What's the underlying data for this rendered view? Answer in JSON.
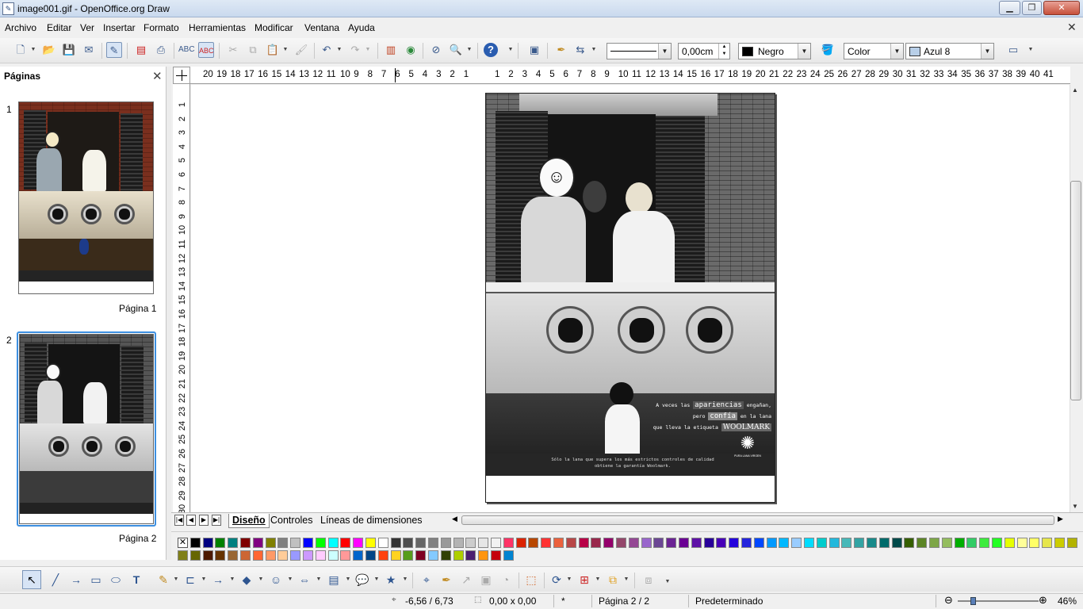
{
  "window": {
    "title": "image001.gif - OpenOffice.org Draw",
    "min_label": "▁",
    "max_label": "❐",
    "close_label": "✕"
  },
  "menu": {
    "items": [
      "Archivo",
      "Editar",
      "Ver",
      "Insertar",
      "Formato",
      "Herramientas",
      "Modificar",
      "Ventana",
      "Ayuda"
    ],
    "close_label": "✕"
  },
  "toolbar": {
    "line_width": "0,00cm",
    "line_color": "Negro",
    "line_color_hex": "#000000",
    "area_style": "Color",
    "area_color": "Azul 8",
    "area_color_hex": "#b8cfe8"
  },
  "pages_panel": {
    "title": "Páginas",
    "close_label": "✕",
    "pages": [
      {
        "number": "1",
        "label": "Página 1"
      },
      {
        "number": "2",
        "label": "Página 2"
      }
    ]
  },
  "ruler": {
    "h_left": [
      "20",
      "19",
      "18",
      "17",
      "16",
      "15",
      "14",
      "13",
      "12",
      "11",
      "10",
      "9",
      "8",
      "7",
      "6",
      "5",
      "4",
      "3",
      "2",
      "1"
    ],
    "h_right": [
      "1",
      "2",
      "3",
      "4",
      "5",
      "6",
      "7",
      "8",
      "9",
      "10",
      "11",
      "12",
      "13",
      "14",
      "15",
      "16",
      "17",
      "18",
      "19",
      "20",
      "21",
      "22",
      "23",
      "24",
      "25",
      "26",
      "27",
      "28",
      "29",
      "30",
      "31",
      "32",
      "33",
      "34",
      "35",
      "36",
      "37",
      "38",
      "39",
      "40",
      "41"
    ],
    "v": [
      "1",
      "2",
      "3",
      "4",
      "5",
      "6",
      "7",
      "8",
      "9",
      "10",
      "11",
      "12",
      "13",
      "14",
      "15",
      "16",
      "17",
      "18",
      "19",
      "20",
      "21",
      "22",
      "23",
      "24",
      "25",
      "26",
      "27",
      "28",
      "29",
      "30"
    ]
  },
  "ad": {
    "line1_pre": "A veces las",
    "line1_highlight": "apariencias",
    "line1_post": "engañan,",
    "line2_pre": "pero",
    "line2_highlight": "confía",
    "line2_post": "en la lana",
    "line3_pre": "que lleva la etiqueta",
    "brand": "WOOLMARK",
    "footer1": "Sólo la lana que supera los más estrictos controles de calidad",
    "footer2": "obtiene la garantía Woolmark.",
    "logo_caption": "PURA LANA VIRGEN"
  },
  "tabs": {
    "nav": [
      "|◀",
      "◀",
      "▶",
      "▶|"
    ],
    "items": [
      "Diseño",
      "Controles",
      "Líneas de dimensiones"
    ]
  },
  "palette": {
    "row1": [
      "#ffffff",
      "#000000",
      "#000080",
      "#008000",
      "#008080",
      "#800000",
      "#800080",
      "#808000",
      "#808080",
      "#c0c0c0",
      "#0000ff",
      "#00ff00",
      "#00ffff",
      "#ff0000",
      "#ff00ff",
      "#ffff00",
      "#ffffff",
      "#333333",
      "#4d4d4d",
      "#666666",
      "#808080",
      "#999999",
      "#b3b3b3",
      "#cccccc",
      "#e6e6e6",
      "#f2f2f2",
      "#ff3366",
      "#dc2300",
      "#b84700",
      "#ff3333",
      "#eb613d",
      "#b84747",
      "#b80047",
      "#99284c",
      "#94006b",
      "#94476b",
      "#944794",
      "#9966cc",
      "#6b4794",
      "#6b2394",
      "#6b0094",
      "#5e11a6",
      "#280099",
      "#4700b8",
      "#2300dc",
      "#2323dc",
      "#0047ff",
      "#0099ff",
      "#00b8ff",
      "#99ccff",
      "#00dcff",
      "#00cccc",
      "#23b8dc",
      "#47b8b8",
      "#33a3a3",
      "#198a8a",
      "#006b6b",
      "#004a4a",
      "#355e00",
      "#5c8526",
      "#7da647",
      "#94bd5e",
      "#00ae00",
      "#33cc66",
      "#3deb3d",
      "#23ff23",
      "#e6ff00",
      "#ffff99",
      "#ffff66",
      "#e6e64c",
      "#cccc00",
      "#b3b300"
    ],
    "row2": [
      "#808019",
      "#666600",
      "#4c1900",
      "#663300",
      "#996633",
      "#cc6633",
      "#ff6633",
      "#ff9966",
      "#ffcc99",
      "#9999ff",
      "#cc99ff",
      "#ffccff",
      "#ccffff",
      "#ff9999",
      "#0066cc",
      "#004586",
      "#ff420e",
      "#ffd320",
      "#579d1c",
      "#7e0021",
      "#83caff",
      "#314004",
      "#aecf00",
      "#4b1f6f",
      "#ff950e",
      "#c5000b",
      "#0084d1"
    ]
  },
  "status": {
    "position": "-6,56 / 6,73",
    "size": "0,00 x 0,00",
    "modified": "*",
    "page": "Página 2 / 2",
    "layout": "Predeterminado",
    "zoom": "46%"
  }
}
